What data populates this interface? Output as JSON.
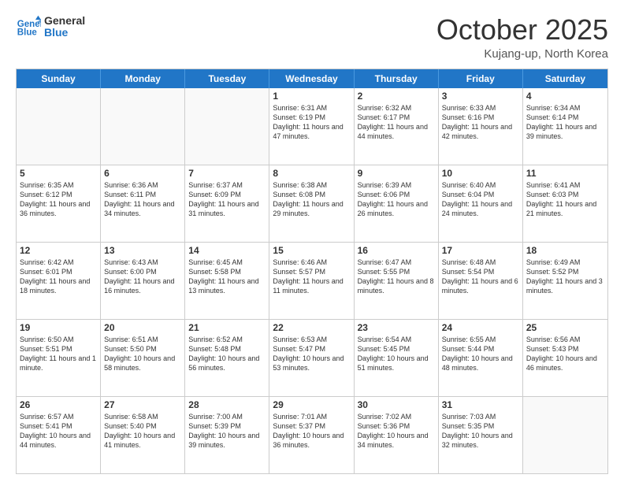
{
  "header": {
    "logo_line1": "General",
    "logo_line2": "Blue",
    "month": "October 2025",
    "location": "Kujang-up, North Korea"
  },
  "days_of_week": [
    "Sunday",
    "Monday",
    "Tuesday",
    "Wednesday",
    "Thursday",
    "Friday",
    "Saturday"
  ],
  "weeks": [
    [
      {
        "day": "",
        "info": ""
      },
      {
        "day": "",
        "info": ""
      },
      {
        "day": "",
        "info": ""
      },
      {
        "day": "1",
        "info": "Sunrise: 6:31 AM\nSunset: 6:19 PM\nDaylight: 11 hours and 47 minutes."
      },
      {
        "day": "2",
        "info": "Sunrise: 6:32 AM\nSunset: 6:17 PM\nDaylight: 11 hours and 44 minutes."
      },
      {
        "day": "3",
        "info": "Sunrise: 6:33 AM\nSunset: 6:16 PM\nDaylight: 11 hours and 42 minutes."
      },
      {
        "day": "4",
        "info": "Sunrise: 6:34 AM\nSunset: 6:14 PM\nDaylight: 11 hours and 39 minutes."
      }
    ],
    [
      {
        "day": "5",
        "info": "Sunrise: 6:35 AM\nSunset: 6:12 PM\nDaylight: 11 hours and 36 minutes."
      },
      {
        "day": "6",
        "info": "Sunrise: 6:36 AM\nSunset: 6:11 PM\nDaylight: 11 hours and 34 minutes."
      },
      {
        "day": "7",
        "info": "Sunrise: 6:37 AM\nSunset: 6:09 PM\nDaylight: 11 hours and 31 minutes."
      },
      {
        "day": "8",
        "info": "Sunrise: 6:38 AM\nSunset: 6:08 PM\nDaylight: 11 hours and 29 minutes."
      },
      {
        "day": "9",
        "info": "Sunrise: 6:39 AM\nSunset: 6:06 PM\nDaylight: 11 hours and 26 minutes."
      },
      {
        "day": "10",
        "info": "Sunrise: 6:40 AM\nSunset: 6:04 PM\nDaylight: 11 hours and 24 minutes."
      },
      {
        "day": "11",
        "info": "Sunrise: 6:41 AM\nSunset: 6:03 PM\nDaylight: 11 hours and 21 minutes."
      }
    ],
    [
      {
        "day": "12",
        "info": "Sunrise: 6:42 AM\nSunset: 6:01 PM\nDaylight: 11 hours and 18 minutes."
      },
      {
        "day": "13",
        "info": "Sunrise: 6:43 AM\nSunset: 6:00 PM\nDaylight: 11 hours and 16 minutes."
      },
      {
        "day": "14",
        "info": "Sunrise: 6:45 AM\nSunset: 5:58 PM\nDaylight: 11 hours and 13 minutes."
      },
      {
        "day": "15",
        "info": "Sunrise: 6:46 AM\nSunset: 5:57 PM\nDaylight: 11 hours and 11 minutes."
      },
      {
        "day": "16",
        "info": "Sunrise: 6:47 AM\nSunset: 5:55 PM\nDaylight: 11 hours and 8 minutes."
      },
      {
        "day": "17",
        "info": "Sunrise: 6:48 AM\nSunset: 5:54 PM\nDaylight: 11 hours and 6 minutes."
      },
      {
        "day": "18",
        "info": "Sunrise: 6:49 AM\nSunset: 5:52 PM\nDaylight: 11 hours and 3 minutes."
      }
    ],
    [
      {
        "day": "19",
        "info": "Sunrise: 6:50 AM\nSunset: 5:51 PM\nDaylight: 11 hours and 1 minute."
      },
      {
        "day": "20",
        "info": "Sunrise: 6:51 AM\nSunset: 5:50 PM\nDaylight: 10 hours and 58 minutes."
      },
      {
        "day": "21",
        "info": "Sunrise: 6:52 AM\nSunset: 5:48 PM\nDaylight: 10 hours and 56 minutes."
      },
      {
        "day": "22",
        "info": "Sunrise: 6:53 AM\nSunset: 5:47 PM\nDaylight: 10 hours and 53 minutes."
      },
      {
        "day": "23",
        "info": "Sunrise: 6:54 AM\nSunset: 5:45 PM\nDaylight: 10 hours and 51 minutes."
      },
      {
        "day": "24",
        "info": "Sunrise: 6:55 AM\nSunset: 5:44 PM\nDaylight: 10 hours and 48 minutes."
      },
      {
        "day": "25",
        "info": "Sunrise: 6:56 AM\nSunset: 5:43 PM\nDaylight: 10 hours and 46 minutes."
      }
    ],
    [
      {
        "day": "26",
        "info": "Sunrise: 6:57 AM\nSunset: 5:41 PM\nDaylight: 10 hours and 44 minutes."
      },
      {
        "day": "27",
        "info": "Sunrise: 6:58 AM\nSunset: 5:40 PM\nDaylight: 10 hours and 41 minutes."
      },
      {
        "day": "28",
        "info": "Sunrise: 7:00 AM\nSunset: 5:39 PM\nDaylight: 10 hours and 39 minutes."
      },
      {
        "day": "29",
        "info": "Sunrise: 7:01 AM\nSunset: 5:37 PM\nDaylight: 10 hours and 36 minutes."
      },
      {
        "day": "30",
        "info": "Sunrise: 7:02 AM\nSunset: 5:36 PM\nDaylight: 10 hours and 34 minutes."
      },
      {
        "day": "31",
        "info": "Sunrise: 7:03 AM\nSunset: 5:35 PM\nDaylight: 10 hours and 32 minutes."
      },
      {
        "day": "",
        "info": ""
      }
    ]
  ]
}
